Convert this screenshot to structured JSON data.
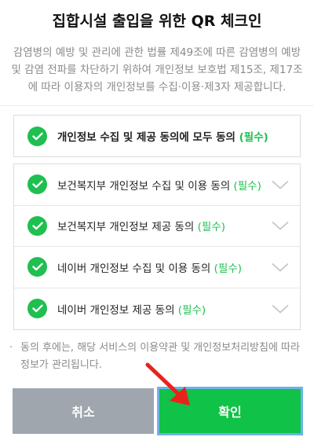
{
  "title": "집합시설 출입을 위한 QR 체크인",
  "description": "감염병의 예방 및 관리에 관한 법률 제49조에 따른 감염병의 예방 및 감염 전파를 차단하기 위하여 개인정보 보호법 제15조, 제17조에 따라 이용자의 개인정보를 수집·이용·제3자 제공합니다.",
  "agree_all": {
    "label": "개인정보 수집 및 제공 동의에 모두 동의",
    "required": "(필수)",
    "checked": true
  },
  "consents": [
    {
      "label": "보건복지부 개인정보 수집 및 이용 동의",
      "required": "(필수)",
      "checked": true,
      "icon": "chevron-down-icon"
    },
    {
      "label": "보건복지부 개인정보 제공 동의",
      "required": "(필수)",
      "checked": true,
      "icon": "chevron-down-icon"
    },
    {
      "label": "네이버 개인정보 수집 및 이용 동의",
      "required": "(필수)",
      "checked": true,
      "icon": "chevron-down-icon"
    },
    {
      "label": "네이버 개인정보 제공 동의",
      "required": "(필수)",
      "checked": true,
      "icon": "chevron-down-icon"
    }
  ],
  "note": {
    "bullet": "·",
    "text": "동의 후에는, 해당 서비스의 이용약관 및 개인정보처리방침에 따라 정보가 관리됩니다."
  },
  "buttons": {
    "cancel_label": "취소",
    "confirm_label": "확인"
  },
  "colors": {
    "accent_green": "#10c247",
    "check_green": "#1fbf50",
    "cancel_gray": "#9fa6ad",
    "annotation_red": "#e8231c"
  }
}
